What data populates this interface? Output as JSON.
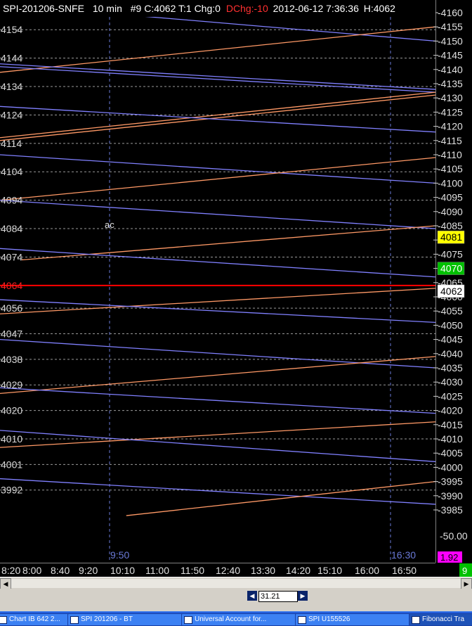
{
  "header": {
    "symbol": "SPI-201206-SNFE",
    "interval": "10 min",
    "stats": "#9 C:4062 T:1 Chg:0",
    "dchg": "DChg:-10",
    "datetime": "2012-06-12 7:36:36",
    "high": "H:4062"
  },
  "chart_data": {
    "type": "line",
    "y_range": [
      3980,
      4162
    ],
    "right_axis_ticks": [
      4160,
      4155,
      4150,
      4145,
      4140,
      4135,
      4130,
      4125,
      4120,
      4115,
      4110,
      4105,
      4100,
      4095,
      4090,
      4085,
      4080,
      4075,
      4070,
      4065,
      4060,
      4055,
      4050,
      4045,
      4040,
      4035,
      4030,
      4025,
      4020,
      4015,
      4010,
      4005,
      4000,
      3995,
      3990,
      3985
    ],
    "left_levels": [
      4154,
      4144,
      4134,
      4124,
      4114,
      4104,
      4094,
      4084,
      4074,
      4064,
      4056,
      4047,
      4038,
      4029,
      4020,
      4010,
      4001,
      3992
    ],
    "highlighted_level": 4064,
    "price_badges": [
      {
        "label": "4081",
        "value": 4081,
        "color": "#ffff00",
        "text_color": "#000000"
      },
      {
        "label": "4070",
        "value": 4070,
        "color": "#00c000",
        "text_color": "#ffffff"
      },
      {
        "label": "4062",
        "value": 4062,
        "color": "#ffffff",
        "text_color": "#000000"
      }
    ],
    "x_labels": [
      "8:20",
      "8:00",
      "8:40",
      "9:20",
      "10:10",
      "11:00",
      "11:50",
      "12:40",
      "13:30",
      "14:20",
      "15:10",
      "16:00",
      "16:50"
    ],
    "vertical_markers": [
      "9:50",
      "16:30"
    ],
    "annotation": "ac",
    "indicator_scale_label": "50.00",
    "indicator_badge": "1.92",
    "indicator_badge_color": "#ff00ff",
    "corner_badge": "9",
    "corner_badge_color": "#00c000",
    "series": [
      {
        "color": "#8080ff",
        "from": [
          0,
          4163
        ],
        "to": [
          1,
          4150
        ]
      },
      {
        "color": "#ff9966",
        "from": [
          0,
          4139
        ],
        "to": [
          1,
          4155
        ]
      },
      {
        "color": "#8080ff",
        "from": [
          0,
          4142
        ],
        "to": [
          1,
          4133
        ]
      },
      {
        "color": "#8080ff",
        "from": [
          0,
          4141
        ],
        "to": [
          1,
          4132
        ]
      },
      {
        "color": "#ff9966",
        "from": [
          0,
          4116
        ],
        "to": [
          1,
          4132
        ]
      },
      {
        "color": "#ff9966",
        "from": [
          0,
          4115
        ],
        "to": [
          1,
          4131
        ]
      },
      {
        "color": "#8080ff",
        "from": [
          0,
          4127
        ],
        "to": [
          1,
          4118
        ]
      },
      {
        "color": "#8080ff",
        "from": [
          0,
          4110
        ],
        "to": [
          1,
          4100
        ]
      },
      {
        "color": "#ff9966",
        "from": [
          0,
          4094
        ],
        "to": [
          1,
          4109
        ]
      },
      {
        "color": "#8080ff",
        "from": [
          0,
          4094
        ],
        "to": [
          1,
          4084
        ]
      },
      {
        "color": "#ff9966",
        "from": [
          0.05,
          4073
        ],
        "to": [
          1,
          4085
        ]
      },
      {
        "color": "#8080ff",
        "from": [
          0,
          4077
        ],
        "to": [
          1,
          4067
        ]
      },
      {
        "color": "#ff9966",
        "from": [
          0,
          4054
        ],
        "to": [
          1,
          4063
        ]
      },
      {
        "color": "#8080ff",
        "from": [
          0,
          4059
        ],
        "to": [
          1,
          4051
        ]
      },
      {
        "color": "#8080ff",
        "from": [
          0,
          4045
        ],
        "to": [
          1,
          4035
        ]
      },
      {
        "color": "#ff9966",
        "from": [
          0,
          4026
        ],
        "to": [
          1,
          4039
        ]
      },
      {
        "color": "#8080ff",
        "from": [
          0,
          4028
        ],
        "to": [
          1,
          4019
        ]
      },
      {
        "color": "#ff9966",
        "from": [
          0,
          4007
        ],
        "to": [
          1,
          4016
        ]
      },
      {
        "color": "#8080ff",
        "from": [
          0,
          4013
        ],
        "to": [
          1,
          4002
        ]
      },
      {
        "color": "#8080ff",
        "from": [
          0,
          3996
        ],
        "to": [
          1,
          3987
        ]
      },
      {
        "color": "#ff9966",
        "from": [
          0.29,
          3983
        ],
        "to": [
          1,
          3995
        ]
      }
    ]
  },
  "statusbar": {
    "field_value": "31.21"
  },
  "taskbar": {
    "items": [
      {
        "label": "Chart IB 642  2..."
      },
      {
        "label": "SPI 201206 - BT"
      },
      {
        "label": "Universal Account for..."
      },
      {
        "label": "SPI  U155526"
      },
      {
        "label": "Fibonacci Tra"
      }
    ]
  }
}
